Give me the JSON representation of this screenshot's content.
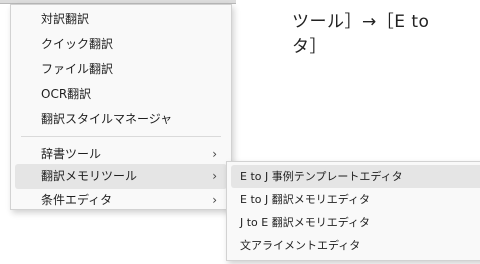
{
  "document": {
    "line1": "ツール］→［E to",
    "line2": "タ］"
  },
  "menu": {
    "items": [
      {
        "label": "対訳翻訳"
      },
      {
        "label": "クイック翻訳"
      },
      {
        "label": "ファイル翻訳"
      },
      {
        "label": "OCR翻訳"
      },
      {
        "label": "翻訳スタイルマネージャ"
      },
      {
        "label": "辞書ツール",
        "arrow": "›"
      },
      {
        "label": "翻訳メモリツール",
        "arrow": "›"
      },
      {
        "label": "条件エディタ",
        "arrow": "›"
      }
    ]
  },
  "submenu": {
    "items": [
      {
        "label": "E to J 事例テンプレートエディタ"
      },
      {
        "label": "E to J 翻訳メモリエディタ"
      },
      {
        "label": "J to E 翻訳メモリエディタ"
      },
      {
        "label": "文アライメントエディタ"
      }
    ]
  }
}
